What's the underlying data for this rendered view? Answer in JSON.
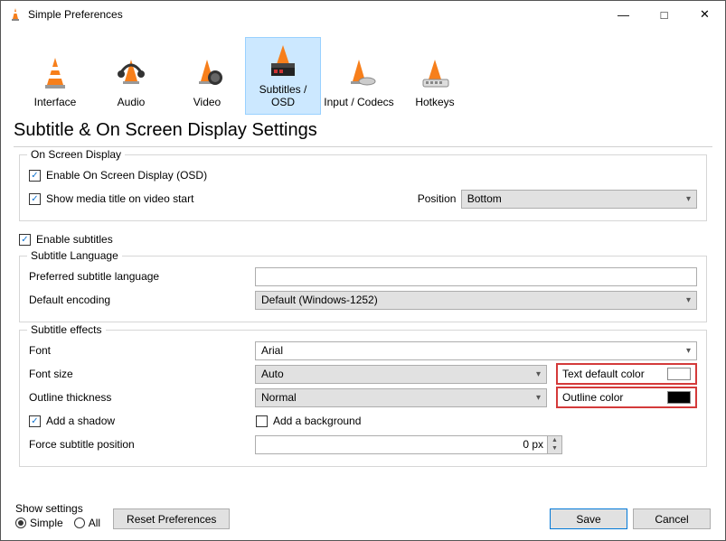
{
  "window": {
    "title": "Simple Preferences"
  },
  "categories": {
    "interface": "Interface",
    "audio": "Audio",
    "video": "Video",
    "subtitles": "Subtitles / OSD",
    "input": "Input / Codecs",
    "hotkeys": "Hotkeys"
  },
  "heading": "Subtitle & On Screen Display Settings",
  "osd": {
    "legend": "On Screen Display",
    "enable_osd": "Enable On Screen Display (OSD)",
    "show_media_title": "Show media title on video start",
    "position_label": "Position",
    "position_value": "Bottom"
  },
  "enable_subtitles": "Enable subtitles",
  "lang": {
    "legend": "Subtitle Language",
    "preferred_label": "Preferred subtitle language",
    "preferred_value": "",
    "encoding_label": "Default encoding",
    "encoding_value": "Default (Windows-1252)"
  },
  "effects": {
    "legend": "Subtitle effects",
    "font_label": "Font",
    "font_value": "Arial",
    "fontsize_label": "Font size",
    "fontsize_value": "Auto",
    "text_color_label": "Text default color",
    "text_color_value": "#ffffff",
    "outline_thickness_label": "Outline thickness",
    "outline_thickness_value": "Normal",
    "outline_color_label": "Outline color",
    "outline_color_value": "#000000",
    "add_shadow": "Add a shadow",
    "add_background": "Add a background",
    "force_pos_label": "Force subtitle position",
    "force_pos_value": "0 px"
  },
  "bottom": {
    "show_settings": "Show settings",
    "simple": "Simple",
    "all": "All",
    "reset": "Reset Preferences",
    "save": "Save",
    "cancel": "Cancel"
  }
}
